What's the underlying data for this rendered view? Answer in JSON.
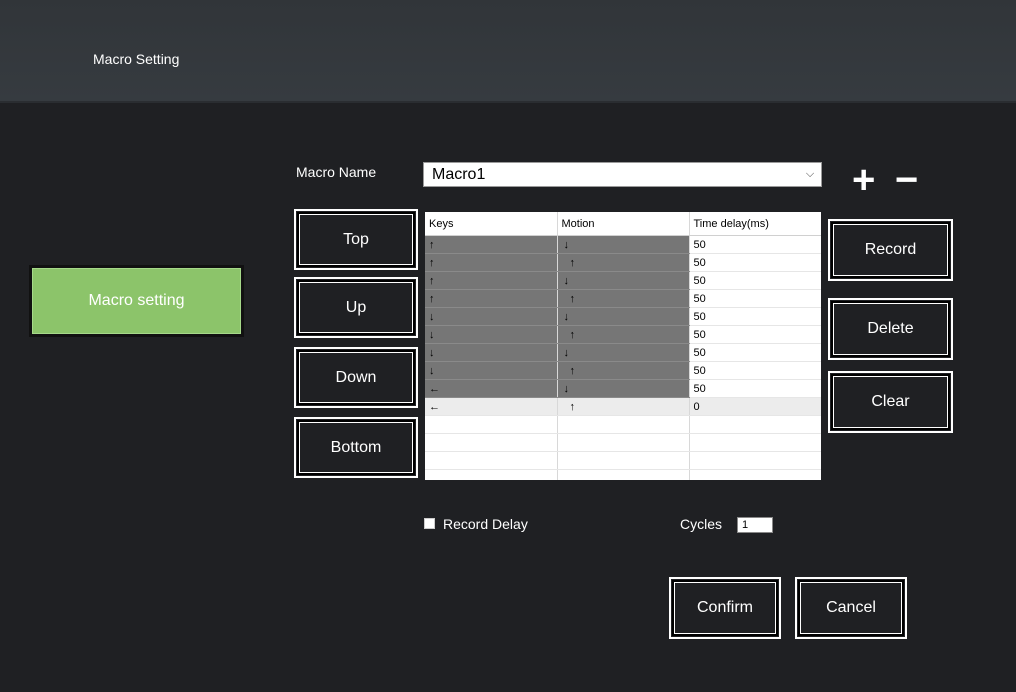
{
  "header": {
    "title": "Macro Setting"
  },
  "sidebar": {
    "macro_setting_label": "Macro setting"
  },
  "form": {
    "macro_name_label": "Macro Name",
    "macro_name_value": "Macro1",
    "add_symbol": "+",
    "remove_symbol": "−"
  },
  "move_buttons": {
    "top": "Top",
    "up": "Up",
    "down": "Down",
    "bottom": "Bottom"
  },
  "action_buttons": {
    "record": "Record",
    "delete": "Delete",
    "clear": "Clear"
  },
  "table": {
    "columns": [
      "Keys",
      "Motion",
      "Time delay(ms)"
    ],
    "rows": [
      {
        "key": "↑",
        "motion": "↓",
        "delay": "50"
      },
      {
        "key": "↑",
        "motion": "↑",
        "delay": "50"
      },
      {
        "key": "↑",
        "motion": "↓",
        "delay": "50"
      },
      {
        "key": "↑",
        "motion": "↑",
        "delay": "50"
      },
      {
        "key": "↓",
        "motion": "↓",
        "delay": "50"
      },
      {
        "key": "↓",
        "motion": "↑",
        "delay": "50"
      },
      {
        "key": "↓",
        "motion": "↓",
        "delay": "50"
      },
      {
        "key": "↓",
        "motion": "↑",
        "delay": "50"
      },
      {
        "key": "←",
        "motion": "↓",
        "delay": "50"
      },
      {
        "key": "←",
        "motion": "↑",
        "delay": "0"
      }
    ]
  },
  "options": {
    "record_delay_label": "Record Delay",
    "record_delay_checked": false,
    "cycles_label": "Cycles",
    "cycles_value": "1"
  },
  "footer": {
    "confirm": "Confirm",
    "cancel": "Cancel"
  },
  "colors": {
    "background": "#1f2023",
    "header": "#363b40",
    "accent_green": "#8cc46a",
    "row_selected": "#767676"
  }
}
